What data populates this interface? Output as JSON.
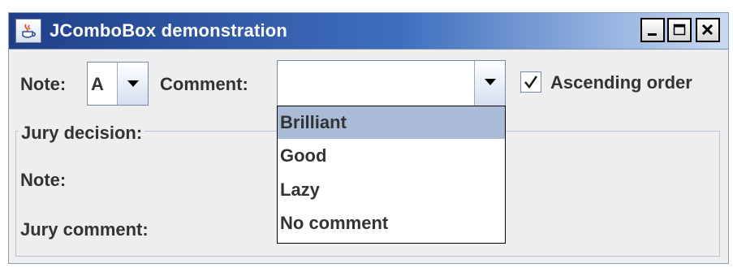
{
  "window": {
    "title": "JComboBox demonstration",
    "title_icon": "java-cup-icon"
  },
  "titlebar_buttons": {
    "minimize_icon": "minimize-icon",
    "maximize_icon": "maximize-icon",
    "close_icon": "close-icon"
  },
  "controls": {
    "note_label": "Note:",
    "note_value": "A",
    "comment_label": "Comment:",
    "comment_value": "",
    "ascending_label": "Ascending order",
    "ascending_checked": true
  },
  "jury_panel": {
    "title": "Jury decision:",
    "note_label": "Note:",
    "comment_label": "Jury comment:"
  },
  "dropdown": {
    "items": [
      "Brilliant",
      "Good",
      "Lazy",
      "No comment"
    ],
    "selected_index": 0
  },
  "colors": {
    "titlebar_start": "#1f3f88",
    "titlebar_end": "#c9daf2",
    "selection": "#a9bbd7",
    "window_bg": "#eeeeee"
  }
}
